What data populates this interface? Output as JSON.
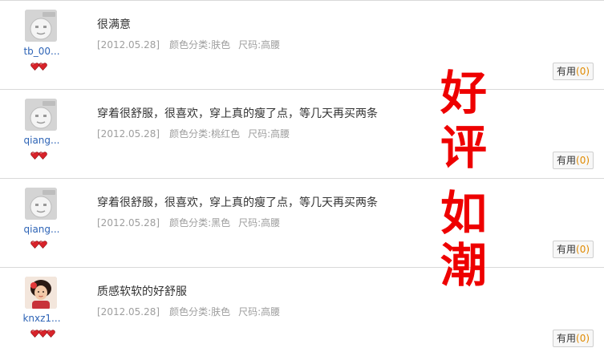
{
  "reviews": [
    {
      "user": "tb_00...",
      "avatar_type": "default-avatar",
      "hearts": 2,
      "content": "很满意",
      "date": "[2012.05.28]",
      "color_label": "颜色分类:肤色",
      "size_label": "尺码:高腰",
      "useful_label": "有用",
      "useful_count": "(0)"
    },
    {
      "user": "qiang...",
      "avatar_type": "default-avatar",
      "hearts": 2,
      "content": "穿着很舒服，很喜欢，穿上真的瘦了点，等几天再买两条",
      "date": "[2012.05.28]",
      "color_label": "颜色分类:桃红色",
      "size_label": "尺码:高腰",
      "useful_label": "有用",
      "useful_count": "(0)"
    },
    {
      "user": "qiang...",
      "avatar_type": "default-avatar",
      "hearts": 2,
      "content": "穿着很舒服，很喜欢，穿上真的瘦了点，等几天再买两条",
      "date": "[2012.05.28]",
      "color_label": "颜色分类:黑色",
      "size_label": "尺码:高腰",
      "useful_label": "有用",
      "useful_count": "(0)"
    },
    {
      "user": "knxz1...",
      "avatar_type": "photo-avatar",
      "hearts": 3,
      "content": "质感软软的好舒服",
      "date": "[2012.05.28]",
      "color_label": "颜色分类:肤色",
      "size_label": "尺码:高腰",
      "useful_label": "有用",
      "useful_count": "(0)"
    }
  ],
  "overlay": {
    "chars": [
      "好",
      "评",
      "如",
      "潮"
    ],
    "color": "#ee0000"
  },
  "colors": {
    "username": "#2e64b6",
    "meta": "#9e9e9e",
    "useful_count": "#e08a00",
    "heart": "#d8232a"
  }
}
